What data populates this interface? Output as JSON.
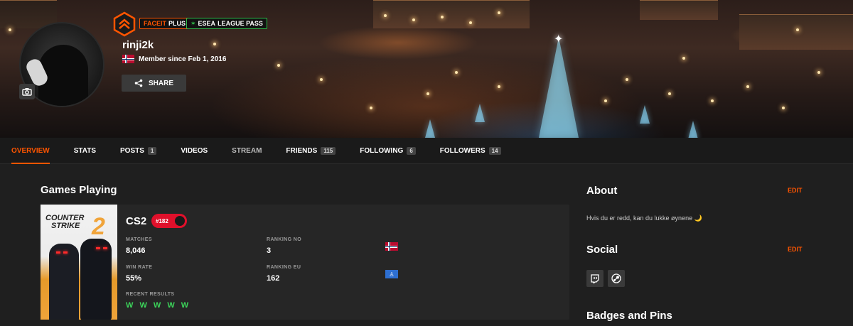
{
  "profile": {
    "username": "rinji2k",
    "member_since": "Member since Feb 1, 2016",
    "share_label": "SHARE",
    "faceit_badge_a": "FACEIT",
    "faceit_badge_b": "PLUS",
    "esea_badge_a": "ESEA",
    "esea_badge_b": "LEAGUE PASS"
  },
  "nav": [
    {
      "label": "OVERVIEW",
      "count": null
    },
    {
      "label": "STATS",
      "count": null
    },
    {
      "label": "POSTS",
      "count": "1"
    },
    {
      "label": "VIDEOS",
      "count": null
    },
    {
      "label": "STREAM",
      "count": null
    },
    {
      "label": "FRIENDS",
      "count": "115"
    },
    {
      "label": "FOLLOWING",
      "count": "6"
    },
    {
      "label": "FOLLOWERS",
      "count": "14"
    }
  ],
  "games": {
    "title": "Games Playing",
    "cover_line1": "COUNTER",
    "cover_line2": "STRIKE",
    "cover_num": "2",
    "game_name": "CS2",
    "rank": "#182",
    "matches_label": "MATCHES",
    "matches": "8,046",
    "ranking_no_label": "RANKING NO",
    "ranking_no": "3",
    "win_rate_label": "WIN RATE",
    "win_rate": "55%",
    "ranking_eu_label": "RANKING EU",
    "ranking_eu": "162",
    "recent_label": "RECENT RESULTS",
    "recent": "W W W W W"
  },
  "about": {
    "title": "About",
    "edit": "EDIT",
    "text": "Hvis du er redd, kan du lukke øynene 🌙"
  },
  "social": {
    "title": "Social",
    "edit": "EDIT"
  },
  "badges": {
    "title": "Badges and Pins"
  },
  "colors": {
    "accent": "#ff5500",
    "win": "#3cd35a",
    "esea": "#2fbf4a"
  }
}
